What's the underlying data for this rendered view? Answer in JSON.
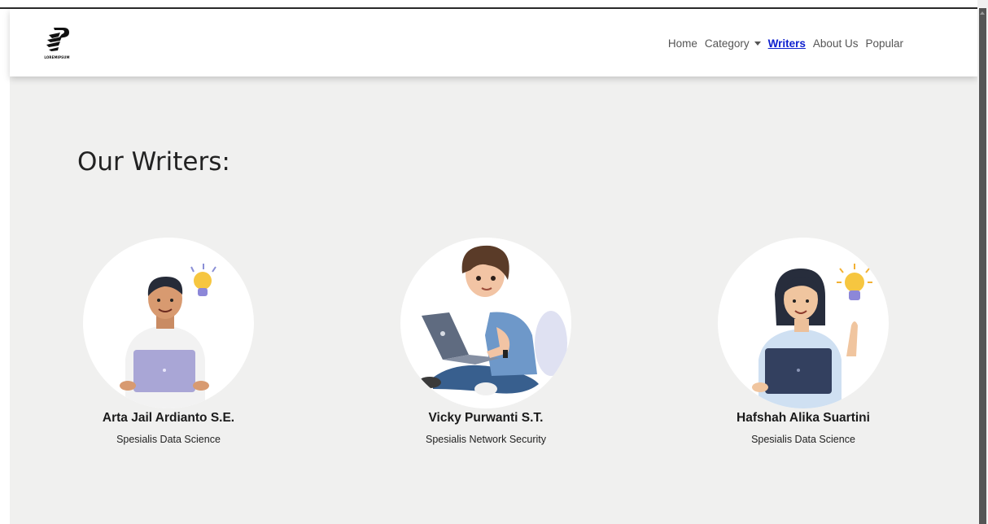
{
  "logo": {
    "icon": "stacked-s-logo-icon",
    "text": "LOREMIPSUM"
  },
  "nav": {
    "items": [
      {
        "label": "Home"
      },
      {
        "label": "Category",
        "has_dropdown": true
      },
      {
        "label": "Writers",
        "active": true
      },
      {
        "label": "About Us"
      },
      {
        "label": "Popular"
      }
    ]
  },
  "page": {
    "heading": "Our Writers:"
  },
  "writers": [
    {
      "name": "Arta Jail Ardianto S.E.",
      "role": "Spesialis Data Science",
      "avatar": "man-with-laptop-and-lightbulb-icon"
    },
    {
      "name": "Vicky Purwanti S.T.",
      "role": "Spesialis Network Security",
      "avatar": "boy-sitting-with-laptop-icon"
    },
    {
      "name": "Hafshah Alika Suartini",
      "role": "Spesialis Data Science",
      "avatar": "woman-with-laptop-and-lightbulb-icon"
    }
  ],
  "colors": {
    "page_bg": "#f0f0ef",
    "nav_bg": "#ffffff",
    "active_link": "#0d1fcf",
    "text": "#222222"
  }
}
